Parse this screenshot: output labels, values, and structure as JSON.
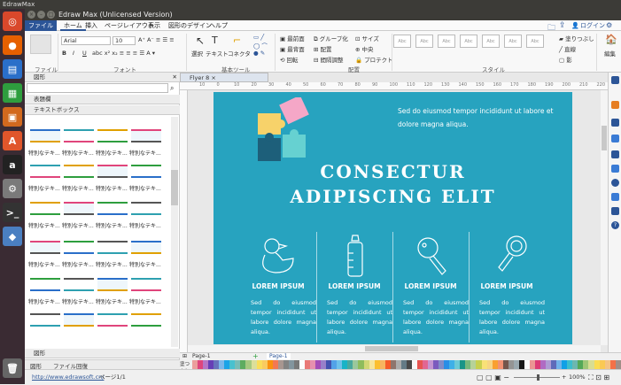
{
  "os": {
    "topbar_title": "EdrawMax"
  },
  "window": {
    "title": "Edraw Max (Unlicensed Version)",
    "login": "ログイン"
  },
  "menu": [
    "ファイル",
    "ホーム",
    "挿入",
    "ページレイアウト",
    "表示",
    "図形のデザイン",
    "ヘルプ"
  ],
  "ribbon": {
    "font_name": "Arial",
    "font_size": "10",
    "groups": {
      "file": "ファイル",
      "font": "フォント",
      "basic_tools": "基本ツール",
      "arrange": "配置",
      "style": "スタイル"
    },
    "select": "選択",
    "text": "テキスト",
    "connector": "コネクタ",
    "arrange_items": [
      "最前面",
      "最背面",
      "回転",
      "グループ化",
      "配置",
      "間隔調整",
      "サイズ",
      "中央",
      "プロテクト"
    ],
    "style_sample": "Abc",
    "fill": "塗りつぶし",
    "line": "直線",
    "shadow": "影",
    "edit": "編集"
  },
  "panel": {
    "title": "図形",
    "section1": "表題欄",
    "section2": "テキストボックス",
    "thumb_label": "特別なテキ...",
    "bottom_section": "図形",
    "bottom_tabs": [
      "図形",
      "ファイル回復"
    ]
  },
  "doc_tab": "Flyer 8",
  "ruler_ticks": [
    "10",
    "0",
    "10",
    "20",
    "30",
    "40",
    "50",
    "60",
    "70",
    "80",
    "90",
    "100",
    "110",
    "120",
    "130",
    "140",
    "150",
    "160",
    "170",
    "180",
    "190",
    "200",
    "210",
    "220"
  ],
  "flyer": {
    "intro": "Sed do eiusmod tempor incididunt ut labore et dolore magna aliqua.",
    "title_line1": "CONSECTUR",
    "title_line2": "ADIPISCING ELIT",
    "columns": [
      {
        "heading": "LOREM IPSUM",
        "body": "Sed do eiusmod tempor incididunt ut labore dolore magna aliqua.",
        "icon": "duck-icon"
      },
      {
        "heading": "LOREM IPSUM",
        "body": "Sed do eiusmod tempor incididunt ut labore dolore magna aliqua.",
        "icon": "baby-bottle-icon"
      },
      {
        "heading": "LOREM IPSUM",
        "body": "Sed do eiusmod tempor incididunt ut labore dolore magna aliqua.",
        "icon": "rattle-icon"
      },
      {
        "heading": "LOREM IPSUM",
        "body": "Sed do eiusmod tempor incididunt ut labore dolore magna aliqua.",
        "icon": "teether-icon"
      }
    ]
  },
  "pages": {
    "current": "Page-1",
    "tab": "Page-1"
  },
  "palette_label": "塗つぶし",
  "status": {
    "url": "http://www.edrawsoft.cn/",
    "page": "ページ1/1",
    "zoom": "100%"
  },
  "colors": {
    "flyer": "#27a3bf",
    "accent": "#2c5597"
  }
}
